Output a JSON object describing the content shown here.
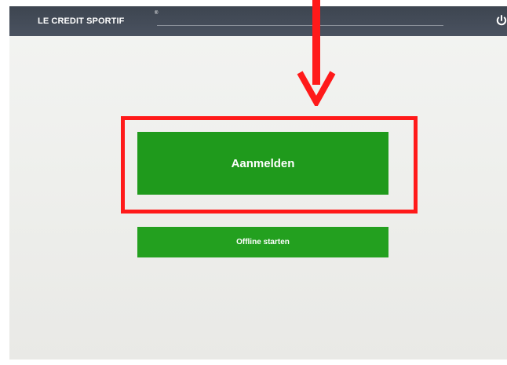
{
  "window": {
    "brand": "LE CREDIT SPORTIF",
    "brand_mark": "®"
  },
  "main": {
    "primary_button_label": "Aanmelden",
    "secondary_button_label": "Offline starten"
  },
  "icons": {
    "power": "power-icon",
    "arrow": "arrow-down-icon"
  },
  "colors": {
    "topbar": "#3d4550",
    "button_green": "#1f9a1c",
    "highlight_red": "#ff1a1a",
    "background": "#f0f1ee"
  }
}
